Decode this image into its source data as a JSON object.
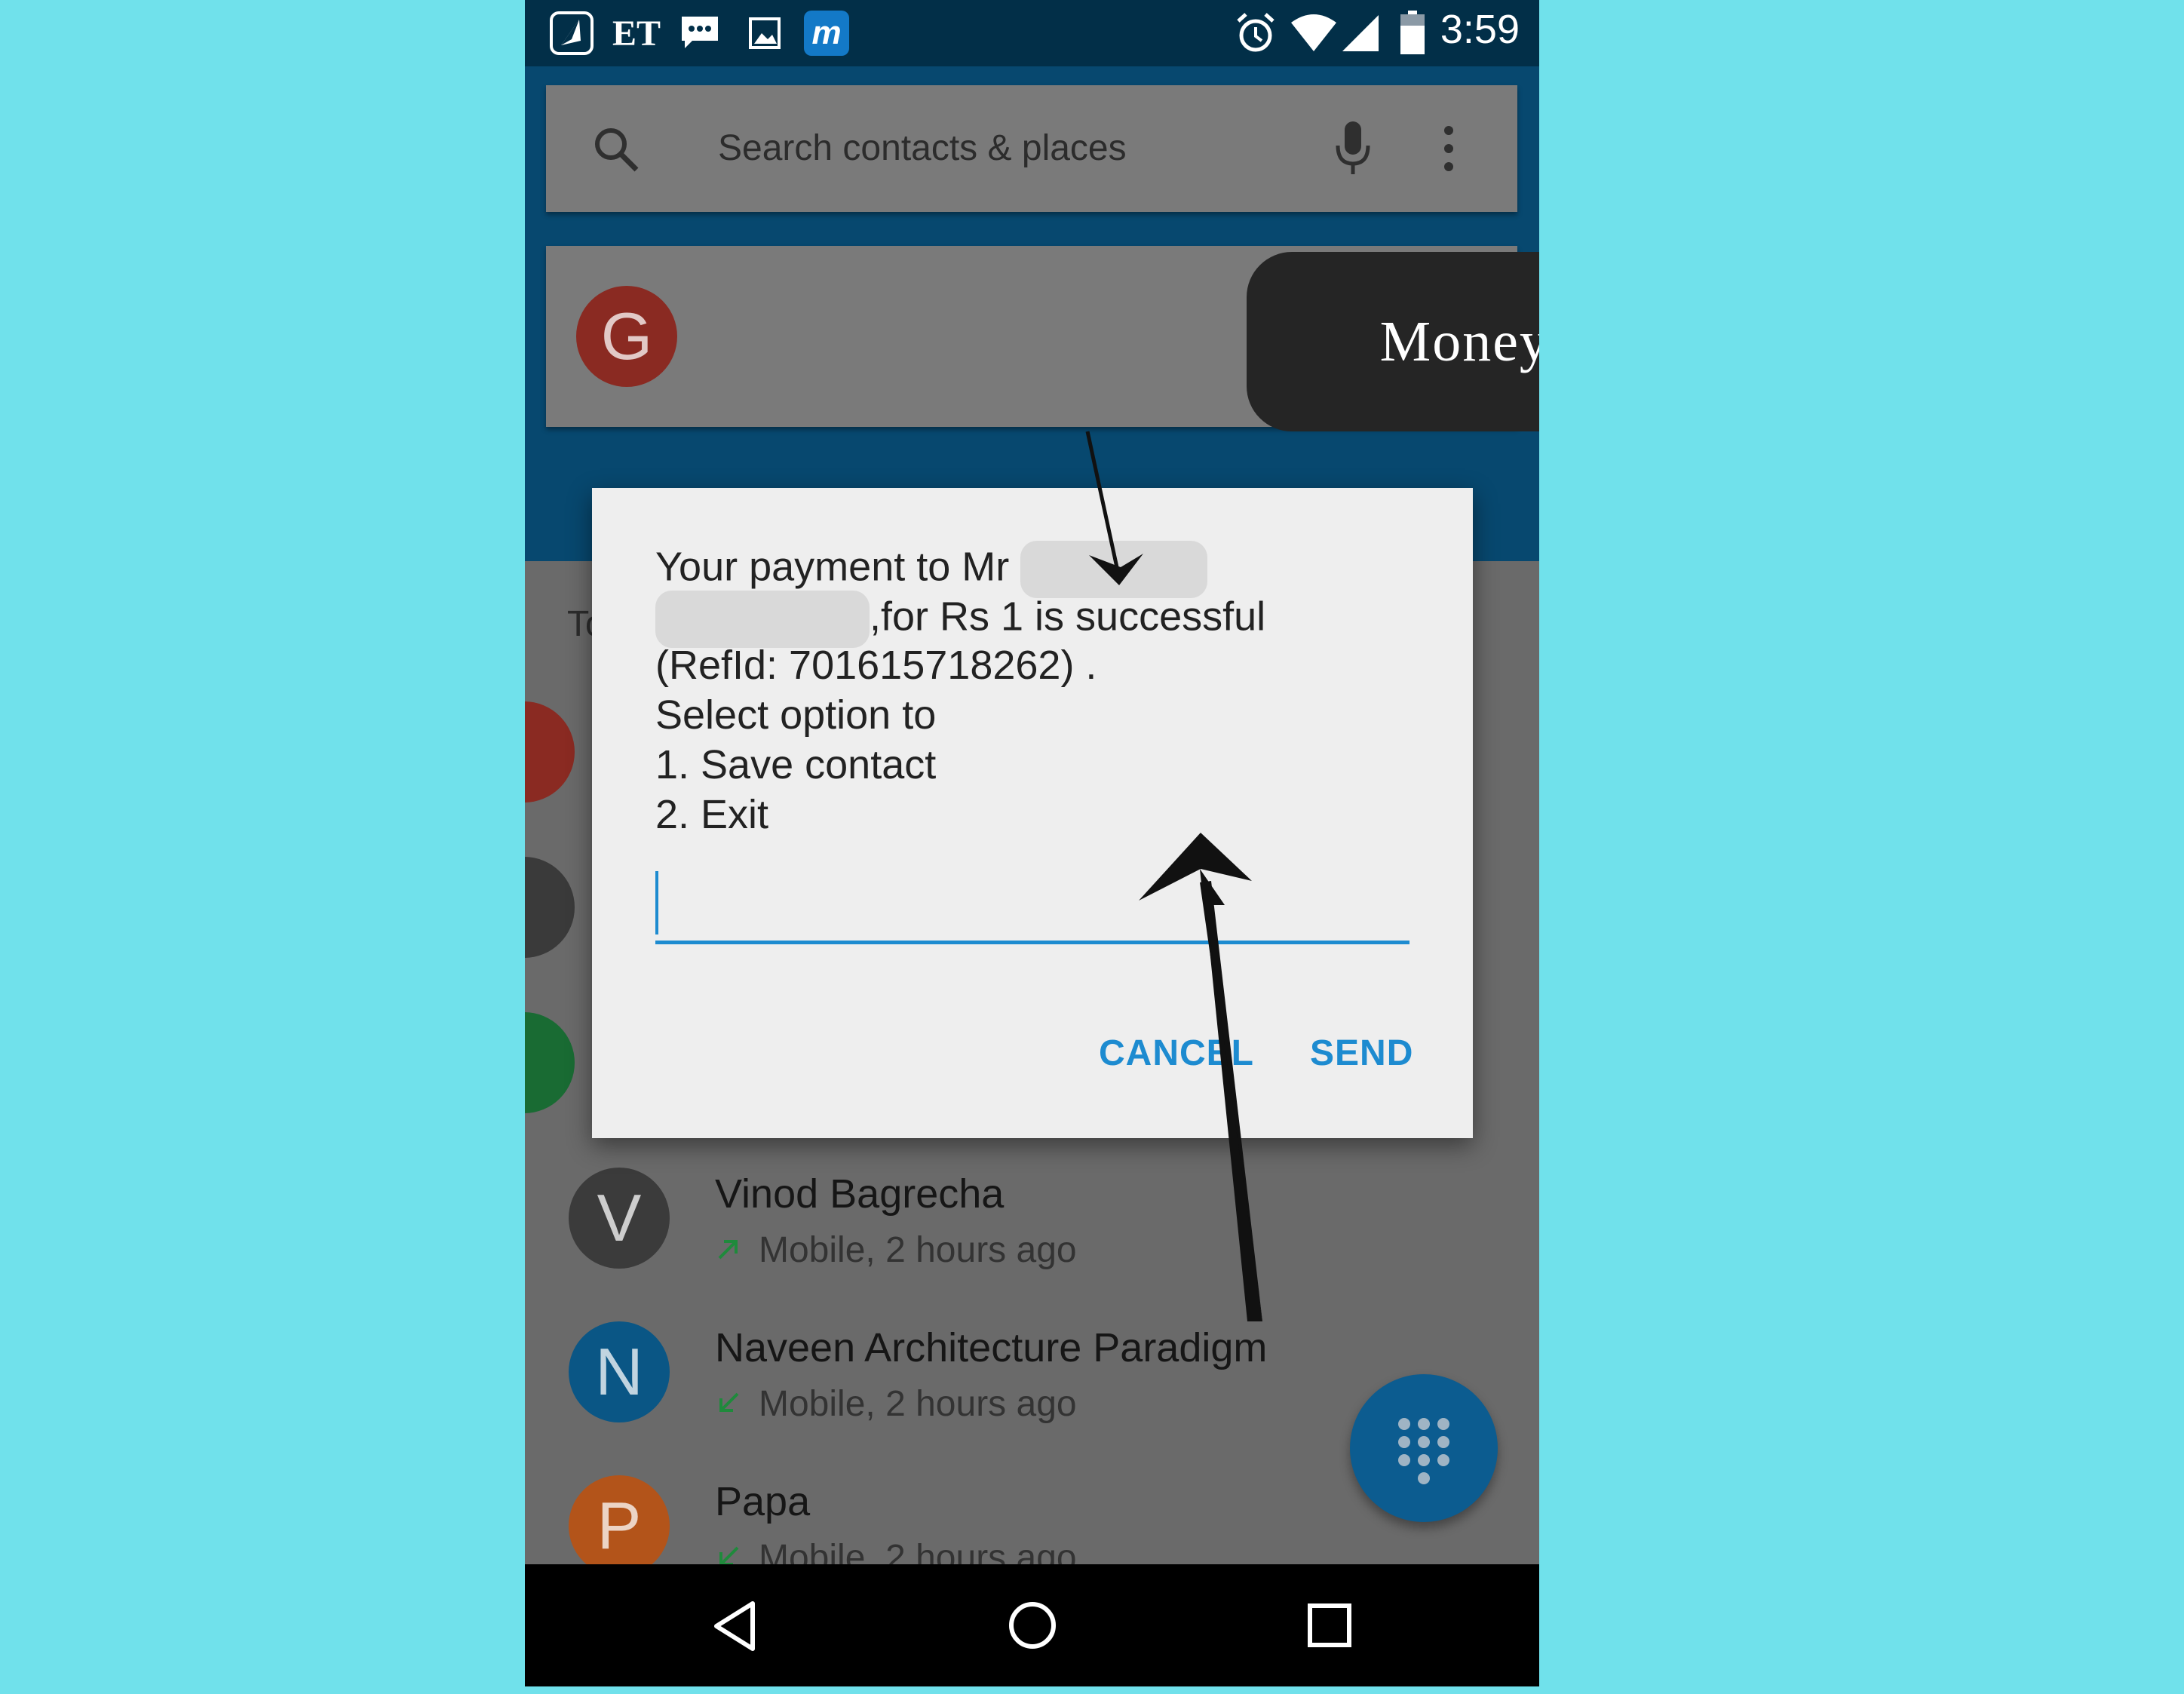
{
  "status_bar": {
    "time": "3:59",
    "left_icons": [
      "kite-app-icon",
      "et-icon",
      "chat-icon",
      "gallery-icon",
      "m-app-icon"
    ],
    "et_label": "ET",
    "m_label": "m",
    "right_icons": [
      "alarm-icon",
      "wifi-icon",
      "signal-icon",
      "battery-icon"
    ]
  },
  "search": {
    "placeholder": "Search contacts & places"
  },
  "favorite_card": {
    "avatar_letter": "G",
    "avatar_color": "#8a2a22"
  },
  "section_label": "To",
  "call_log": [
    {
      "letter": "V",
      "name": "Vinod Bagrecha",
      "sub": "Mobile, 2 hours ago",
      "direction": "outgoing",
      "avatar_color": "#3b3b3b"
    },
    {
      "letter": "N",
      "name": "Naveen Architecture Paradigm",
      "sub": "Mobile, 2 hours ago",
      "direction": "incoming",
      "avatar_color": "#0a5685"
    },
    {
      "letter": "P",
      "name": "Papa",
      "sub": "Mobile, 2 hours ago",
      "direction": "incoming",
      "avatar_color": "#b3541a"
    }
  ],
  "partial_avatars": [
    {
      "color": "#8a2a22"
    },
    {
      "color": "#3a3a3a"
    },
    {
      "color": "#196b33"
    }
  ],
  "dialog": {
    "line1": "Your payment to Mr",
    "line2": ",for Rs 1 is successful",
    "line3": "(RefId: 701615718262) .",
    "line4": "Select option to",
    "line5": "1. Save contact",
    "line6": "2. Exit",
    "input_value": "",
    "cancel_label": "CANCEL",
    "send_label": "SEND"
  },
  "callout": {
    "text": "Money sent"
  },
  "colors": {
    "accent": "#1d8bd0",
    "background": "#70e1eb",
    "status_bar": "#022f48",
    "header": "#07486f"
  }
}
